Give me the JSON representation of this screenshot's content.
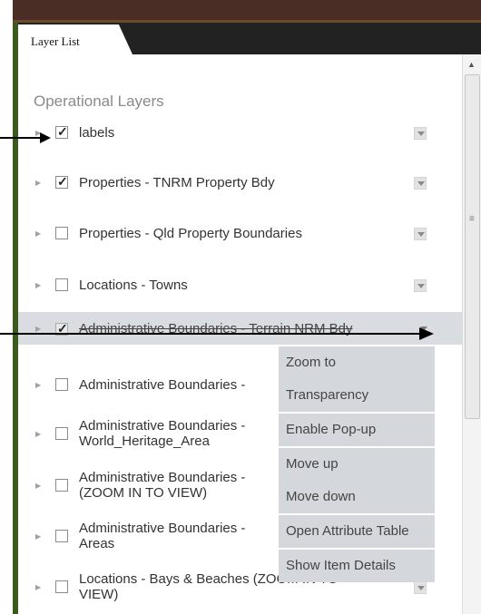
{
  "panel": {
    "tab_label": "Layer List",
    "section_title": "Operational Layers"
  },
  "layers": [
    {
      "label": "labels",
      "checked": true
    },
    {
      "label": "Properties - TNRM Property Bdy",
      "checked": true
    },
    {
      "label": "Properties - Qld Property Boundaries",
      "checked": false
    },
    {
      "label": "Locations - Towns",
      "checked": false
    },
    {
      "label": "Administrative Boundaries - Terrain NRM Bdy",
      "checked": true
    },
    {
      "label": "Administrative Boundaries -",
      "checked": false
    },
    {
      "label": "Administrative Boundaries -",
      "label2": "World_Heritage_Area",
      "checked": false
    },
    {
      "label": "Administrative Boundaries -",
      "label2": "(ZOOM IN TO VIEW)",
      "checked": false
    },
    {
      "label": "Administrative Boundaries -",
      "label2": "Areas",
      "checked": false
    },
    {
      "label": "Locations - Bays & Beaches (ZOOM IN TO",
      "label2": "VIEW)",
      "checked": false
    }
  ],
  "context_menu": {
    "items": [
      "Zoom to",
      "Transparency",
      "Enable Pop-up",
      "Move up",
      "Move down",
      "Open Attribute Table",
      "Show Item Details"
    ]
  },
  "icons": {
    "checkbox_checked": "checkmark-icon",
    "expand": "expand-triangle-icon",
    "dropdown": "chevron-down-icon"
  },
  "colors": {
    "highlight_row": "#d9dde2",
    "menu_bg": "#d4d8dc",
    "frame": "#3d5a1e",
    "tabstrip": "#222222"
  }
}
